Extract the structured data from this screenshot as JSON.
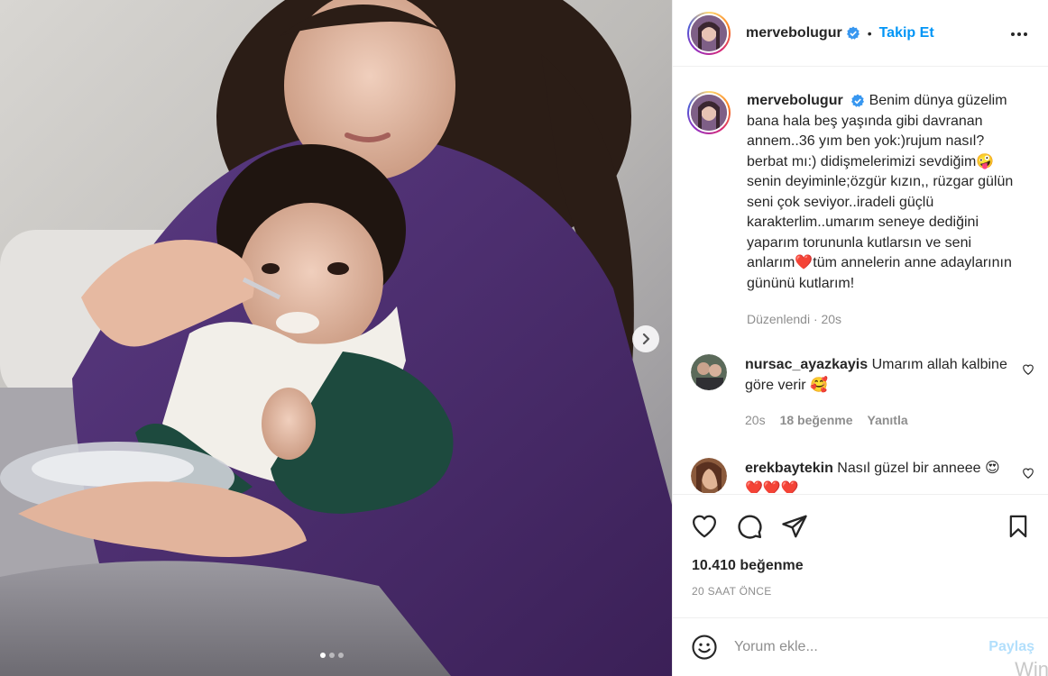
{
  "post": {
    "image_alt": "Mother feeding a toddler in a vintage photo",
    "carousel_dots": 3,
    "active_dot": 0
  },
  "header": {
    "username": "mervebolugur",
    "separator": "•",
    "follow_label": "Takip Et"
  },
  "caption": {
    "username": "mervebolugur",
    "text": "Benim dünya güzelim bana hala beş yaşında gibi davranan annem..36 yım ben yok:)rujum nasıl? berbat mı:) didişmelerimizi sevdiğim🤪 senin deyiminle;özgür kızın,, rüzgar gülün seni çok seviyor..iradeli güçlü karakterlim..umarım seneye dediğini yaparım torununla kutlarsın ve seni anlarım❤️tüm annelerin anne adaylarının gününü kutlarım!",
    "meta": "Düzenlendi · 20s"
  },
  "comments": [
    {
      "username": "nursac_ayazkayis",
      "text": "Umarım allah kalbine göre verir 🥰",
      "time": "20s",
      "likes": "18 beğenme",
      "reply": "Yanıtla"
    },
    {
      "username": "erekbaytekin",
      "text": "Nasıl güzel bir anneee 😍❤️❤️❤️"
    }
  ],
  "actions": {
    "likes": "10.410 beğenme",
    "time": "20 SAAT ÖNCE"
  },
  "comment_box": {
    "placeholder": "Yorum ekle...",
    "share_label": "Paylaş"
  },
  "watermark": "Win",
  "colors": {
    "link_blue": "#0095f6",
    "share_disabled": "#b2dffc",
    "muted_text": "#8e8e8e",
    "sweater_purple": "#4a2a6b"
  }
}
